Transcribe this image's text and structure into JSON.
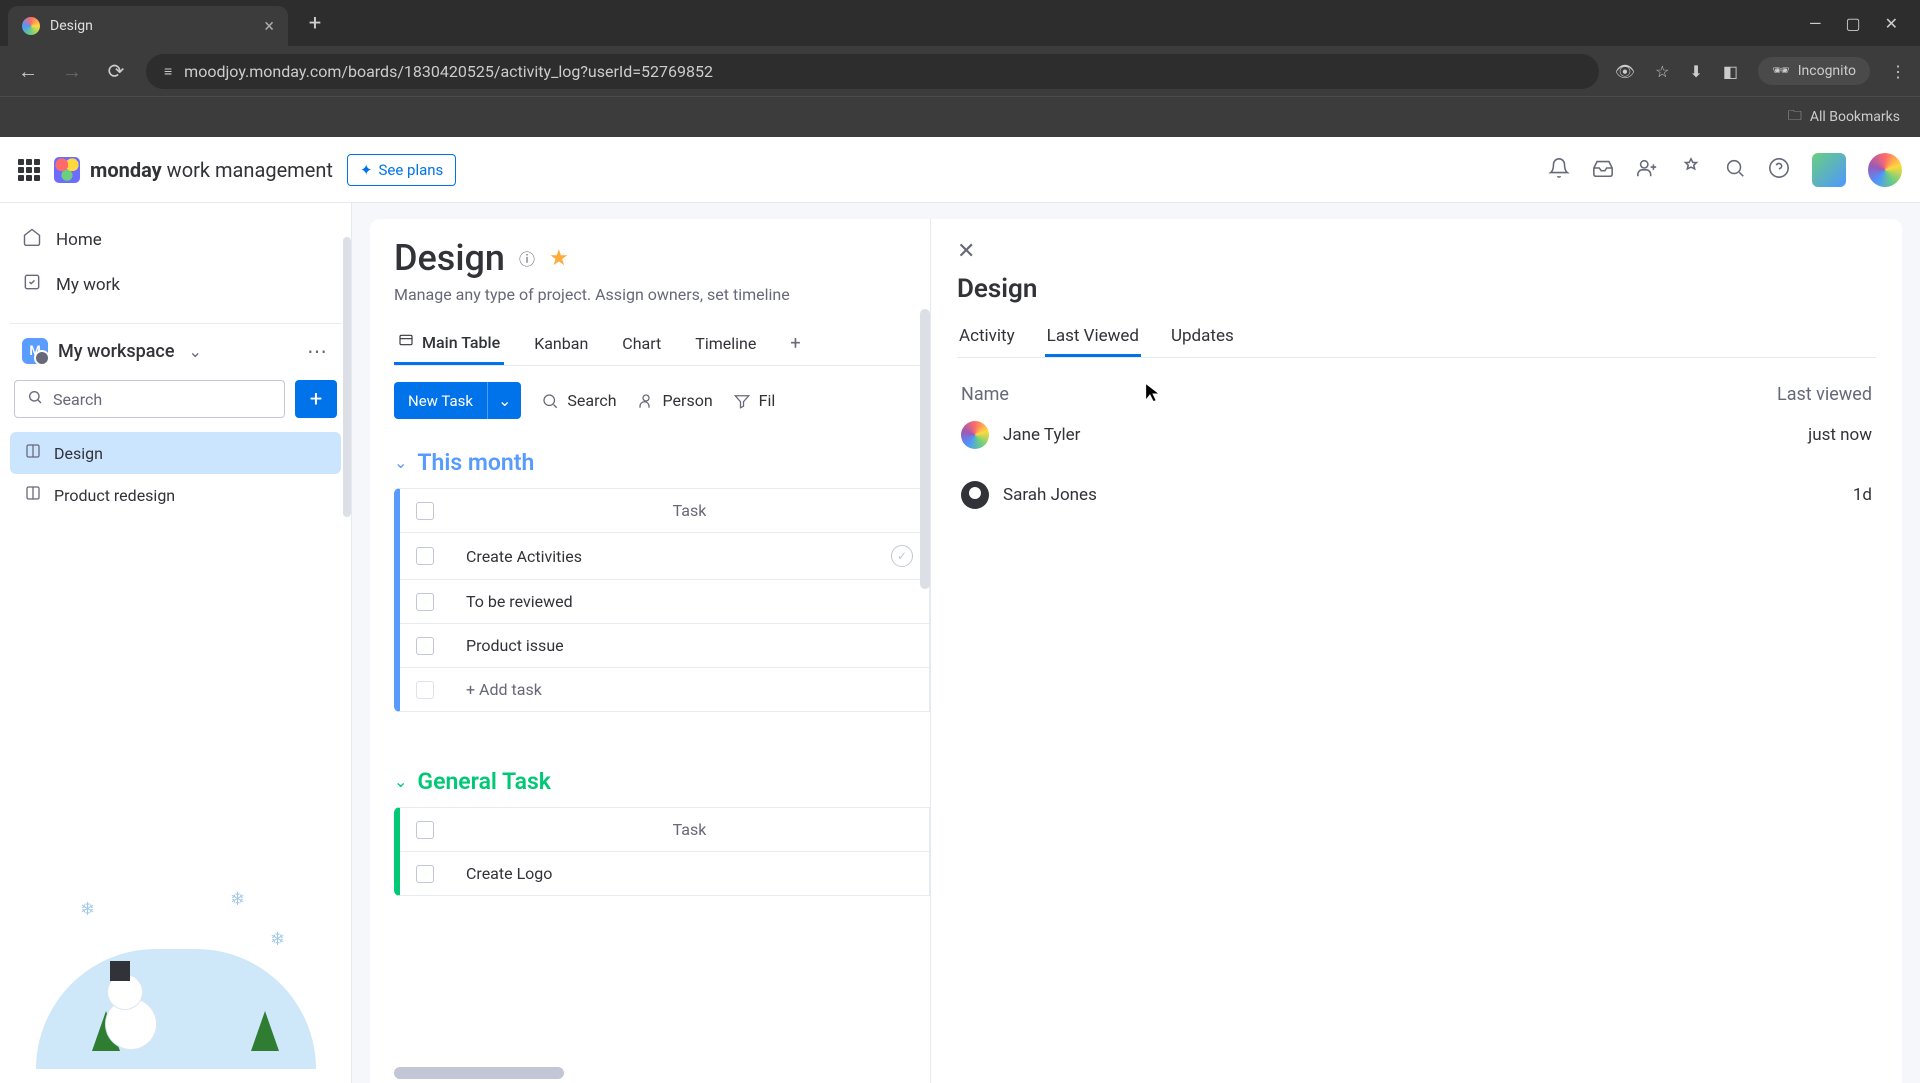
{
  "browser": {
    "tab_title": "Design",
    "url": "moodjoy.monday.com/boards/1830420525/activity_log?userId=52769852",
    "incognito_label": "Incognito",
    "bookmarks_label": "All Bookmarks"
  },
  "header": {
    "brand_bold": "monday",
    "brand_rest": " work management",
    "see_plans": "See plans"
  },
  "sidebar": {
    "home": "Home",
    "mywork": "My work",
    "workspace": "My workspace",
    "search_placeholder": "Search",
    "boards": [
      {
        "name": "Design",
        "active": true
      },
      {
        "name": "Product redesign",
        "active": false
      }
    ]
  },
  "board": {
    "title": "Design",
    "description": "Manage any type of project. Assign owners, set timeline",
    "tabs": {
      "main": "Main Table",
      "kanban": "Kanban",
      "chart": "Chart",
      "timeline": "Timeline"
    },
    "toolbar": {
      "new_task": "New Task",
      "search": "Search",
      "person": "Person",
      "filter": "Fil"
    },
    "column_task_header": "Task",
    "add_task_label": "+ Add task",
    "groups": [
      {
        "name": "This month",
        "color": "blue",
        "tasks": [
          {
            "name": "Create Activities",
            "check": true
          },
          {
            "name": "To be reviewed",
            "check": false
          },
          {
            "name": "Product issue",
            "check": false
          }
        ]
      },
      {
        "name": "General Task",
        "color": "green",
        "tasks": [
          {
            "name": "Create Logo",
            "check": false
          }
        ]
      }
    ]
  },
  "panel": {
    "title": "Design",
    "tabs": {
      "activity": "Activity",
      "last_viewed": "Last Viewed",
      "updates": "Updates"
    },
    "col_name": "Name",
    "col_time": "Last viewed",
    "rows": [
      {
        "name": "Jane Tyler",
        "time": "just now",
        "avatar": "rainbow"
      },
      {
        "name": "Sarah Jones",
        "time": "1d",
        "avatar": "dark"
      }
    ]
  }
}
